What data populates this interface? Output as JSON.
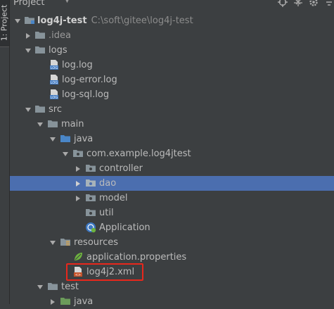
{
  "sidebar": {
    "tab_label": "1: Project"
  },
  "header": {
    "title": "Project"
  },
  "tree": {
    "root": {
      "name": "log4j-test",
      "path": "C:\\soft\\gitee\\log4j-test"
    },
    "idea": ".idea",
    "logs": "logs",
    "log_files": [
      "log.log",
      "log-error.log",
      "log-sql.log"
    ],
    "src": "src",
    "main": "main",
    "java": "java",
    "package": "com.example.log4jtest",
    "controller": "controller",
    "dao": "dao",
    "model": "model",
    "util": "util",
    "application": "Application",
    "resources": "resources",
    "app_props": "application.properties",
    "log4j2": "log4j2.xml",
    "test": "test",
    "test_java": "java"
  },
  "colors": {
    "background": "#3c3f41",
    "selection": "#4b6eaf",
    "highlight_box": "#e8271c",
    "folder": "#87939a",
    "source_folder": "#4a86c7",
    "test_folder": "#6b9b5a"
  }
}
